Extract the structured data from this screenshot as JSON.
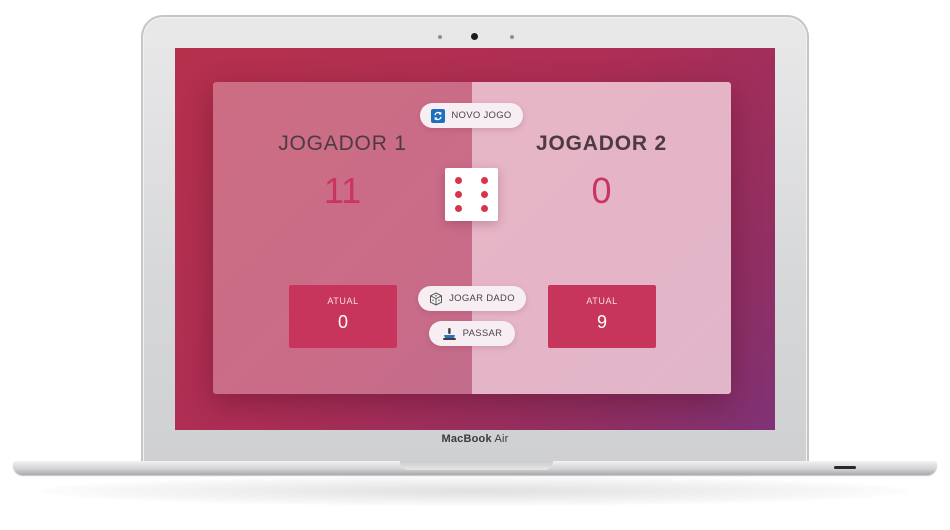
{
  "device": {
    "brand_bold": "MacBook",
    "brand_light": "Air"
  },
  "game": {
    "new_game_label": "NOVO JOGO",
    "roll_dice_label": "JOGAR DADO",
    "hold_label": "PASSAR",
    "dice_value": 6,
    "players": [
      {
        "name": "JOGADOR 1",
        "score": "11",
        "current_label": "ATUAL",
        "current": "0",
        "active": false
      },
      {
        "name": "JOGADOR 2",
        "score": "0",
        "current_label": "ATUAL",
        "current": "9",
        "active": true
      }
    ]
  },
  "colors": {
    "accent": "#c8355c",
    "pip": "#d8344b",
    "background_start": "#b5304b",
    "background_end": "#7f3275"
  },
  "icons": {
    "new_game": "refresh-icon",
    "roll_dice": "dice-icon",
    "hold": "hold-icon"
  }
}
